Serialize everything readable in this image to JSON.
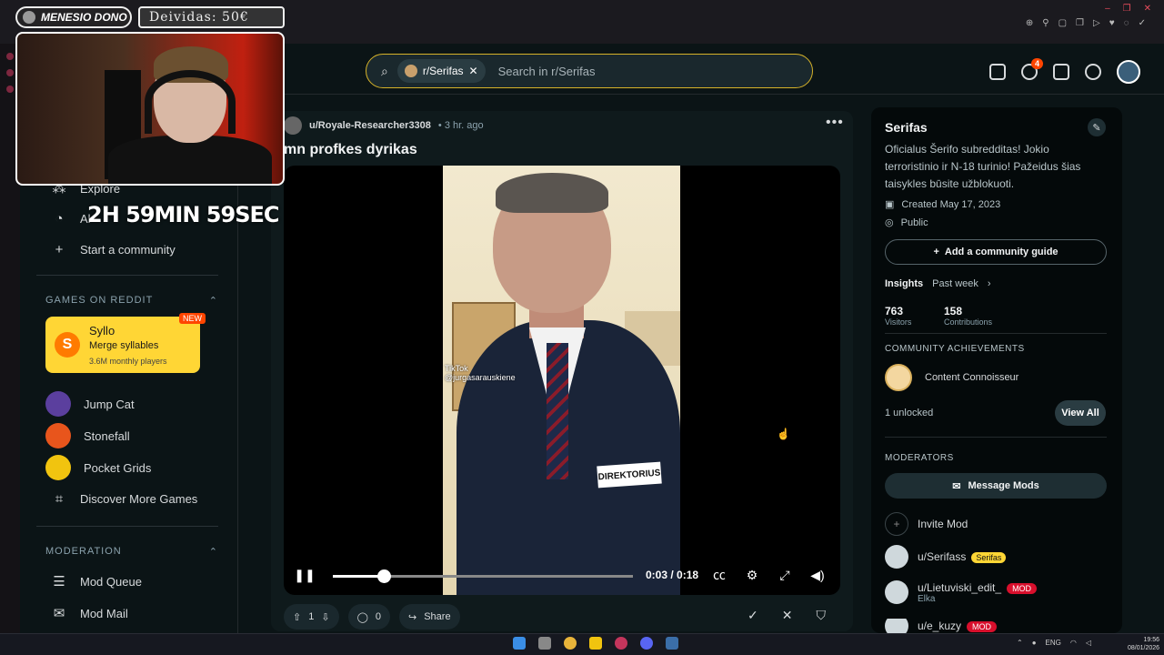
{
  "overlay": {
    "donor_label": "MENESIO DONO",
    "debt_label": "Deividas: 50€",
    "timer": "2H 59MIN 59SEC"
  },
  "header": {
    "search_chip": "r/Serifas",
    "search_placeholder": "Search in r/Serifas",
    "chat_badge": "4"
  },
  "sidebar": {
    "explore_label": "Explore",
    "all_label": "Al",
    "start_community": "Start a community",
    "games_title": "GAMES ON REDDIT",
    "featured_game": {
      "name": "Syllo",
      "subtitle": "Merge syllables",
      "players": "3.6M monthly players",
      "badge": "NEW",
      "logo_letter": "S"
    },
    "games": [
      {
        "label": "Jump Cat"
      },
      {
        "label": "Stonefall"
      },
      {
        "label": "Pocket Grids"
      },
      {
        "label": "Discover More Games"
      }
    ],
    "moderation_title": "MODERATION",
    "moderation_items": [
      {
        "label": "Mod Queue"
      },
      {
        "label": "Mod Mail"
      }
    ]
  },
  "post": {
    "author": "u/Royale-Researcher3308",
    "time": "• 3 hr. ago",
    "title": "mn profkes dyrikas",
    "video": {
      "name_tag": "DIREKTORIUS",
      "tiktok_label": "TikTok",
      "tiktok_user": "@jurgasarauskiene",
      "current": "0:03",
      "duration": "0:18",
      "time_display": "0:03 / 0:18",
      "progress": 0.17
    },
    "votes": "1",
    "comments": "0",
    "share_label": "Share"
  },
  "community": {
    "name": "Serifas",
    "description": "Oficialus Šerifo subredditas! Jokio terroristinio ir N-18 turinio! Pažeidus šias taisykles būsite užblokuoti.",
    "created": "Created May 17, 2023",
    "visibility": "Public",
    "guide_button": "Add a community guide",
    "insights_label": "Insights",
    "insights_range": "Past week",
    "visitors_value": "763",
    "visitors_label": "Visitors",
    "contributions_value": "158",
    "contributions_label": "Contributions",
    "achievements_title": "COMMUNITY ACHIEVEMENTS",
    "achievement": "Content Connoisseur",
    "unlocked": "1 unlocked",
    "view_all": "View All",
    "moderators_title": "MODERATORS",
    "message_mods": "Message Mods",
    "invite_mod": "Invite Mod",
    "mods": [
      {
        "name": "u/Serifass",
        "flair": "Serifas"
      },
      {
        "name": "u/Lietuviski_edit_",
        "flair": "MOD",
        "sub": "Elka"
      },
      {
        "name": "u/e_kuzy",
        "flair": "MOD"
      }
    ]
  },
  "taskbar": {
    "lang": "ENG",
    "time": "19:56",
    "date": "08/01/2026"
  },
  "colors": {
    "accent": "#ff4500",
    "search_border": "#d6b229",
    "background": "#0b1416"
  }
}
